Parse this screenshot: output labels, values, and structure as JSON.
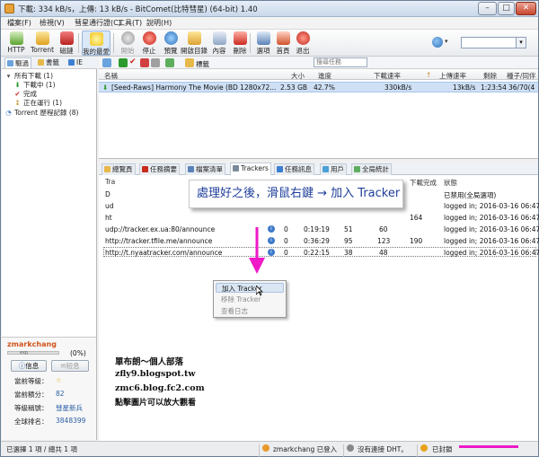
{
  "window": {
    "title": "下載: 334 kB/s，上傳: 13 kB/s - BitComet(比特彗星) (64-bit) 1.40",
    "min": "–",
    "max": "□",
    "close": "✕"
  },
  "menu": [
    "檔案(F)",
    "檢視(V)",
    "彗星通行證(C)",
    "工具(T)",
    "說明(H)"
  ],
  "toolbar": {
    "buttons": [
      {
        "label": "HTTP",
        "icon": "http-icon"
      },
      {
        "label": "Torrent",
        "icon": "torrent-icon"
      },
      {
        "label": "磁鏈",
        "icon": "magnet-icon"
      },
      {
        "label": "我的最愛",
        "icon": "favorites-star-icon"
      },
      {
        "label": "開始",
        "icon": "start-icon"
      },
      {
        "label": "停止",
        "icon": "stop-icon"
      },
      {
        "label": "預覽",
        "icon": "preview-icon"
      },
      {
        "label": "開啟目錄",
        "icon": "open-folder-icon"
      },
      {
        "label": "內容",
        "icon": "properties-icon"
      },
      {
        "label": "刪除",
        "icon": "delete-icon"
      },
      {
        "label": "選項",
        "icon": "options-icon"
      },
      {
        "label": "首頁",
        "icon": "home-icon"
      },
      {
        "label": "退出",
        "icon": "exit-icon"
      }
    ],
    "search_value": ""
  },
  "left_tabs": [
    "驅過",
    "書籤",
    "IE"
  ],
  "tree": [
    {
      "label": "所有下載 (1)",
      "icon": "all-downloads-icon"
    },
    {
      "label": "下載中 (1)",
      "icon": "downloading-icon"
    },
    {
      "label": "完成",
      "icon": "completed-icon"
    },
    {
      "label": "正在運行 (1)",
      "icon": "running-icon"
    },
    {
      "label": "Torrent 歷程記錄 (8)",
      "icon": "history-icon"
    }
  ],
  "filter": {
    "tag_label": "標籤",
    "search_placeholder": "搜尋任務"
  },
  "task_columns": [
    "名稱",
    "大小",
    "進度",
    "下載速率",
    "上傳速率",
    "剩餘",
    "種子/同伴"
  ],
  "task": {
    "name": "[Seed-Raws] Harmony The Movie (BD 1280x72...",
    "size": "2.53 GB",
    "progress": "42.7%",
    "dl": "330kB/s",
    "ul": "13kB/s",
    "remaining": "1:23:54",
    "seeds": "36/70(4"
  },
  "detail_tabs": [
    "總覽頁",
    "任務摘要",
    "檔案清單",
    "Trackers",
    "任務訊息",
    "用戶",
    "全局統計"
  ],
  "tracker_columns": [
    "Tra",
    "下載完成",
    "狀態"
  ],
  "trackers": [
    {
      "url": "D",
      "b": "",
      "c": "",
      "d": "",
      "done": "",
      "status": "已禁用(全局選項)"
    },
    {
      "url": "ud",
      "b": "",
      "c": "",
      "d": "",
      "done": "",
      "status": "logged in; 2016-03-16 06:47"
    },
    {
      "url": "ht",
      "b": "",
      "c": "",
      "d": "",
      "done": "164",
      "status": "logged in; 2016-03-16 06:47"
    },
    {
      "url": "udp://tracker.ex.ua:80/announce",
      "b": "0",
      "c": "0:19:19",
      "d": "51",
      "e": "60",
      "done": "",
      "status": "logged in; 2016-03-16 06:47"
    },
    {
      "url": "http://tracker.tfile.me/announce",
      "b": "0",
      "c": "0:36:29",
      "d": "95",
      "e": "123",
      "done": "190",
      "status": "logged in; 2016-03-16 06:47"
    },
    {
      "url": "http://t.nyaatracker.com/announce",
      "b": "0",
      "c": "0:22:15",
      "d": "38",
      "e": "48",
      "done": "",
      "status": "logged in; 2016-03-16 06:47"
    }
  ],
  "callout": "處理好之後，滑鼠右鍵 → 加入 Tracker",
  "context_menu": [
    "加入 Tracker",
    "移除 Tracker",
    "查看日志"
  ],
  "profile": {
    "name": "zmarkchang",
    "exp": "exp",
    "pct": "(0%)",
    "info_btn": "信息",
    "msg_btn": "短息",
    "rows": [
      {
        "k": "當前等級：",
        "v": "☆"
      },
      {
        "k": "當前積分：",
        "v": "82"
      },
      {
        "k": "等級稱號：",
        "v": "彗星新兵"
      },
      {
        "k": "全球排名：",
        "v": "3848399"
      }
    ]
  },
  "blog": [
    "單布朗～個人部落",
    "zfly9.blogspot.tw",
    "zmc6.blog.fc2.com",
    "點擊圖片可以放大觀看"
  ],
  "status": {
    "selected": "已選擇 1 項 / 總共 1 項",
    "user": "zmarkchang 已登入",
    "dht": "沒有連接 DHT。",
    "blocked": "已封鎖"
  },
  "colors": {
    "accent": "#ee1ac7",
    "callout_text": "#1f3e9a",
    "selection": "#cfe0f5"
  }
}
